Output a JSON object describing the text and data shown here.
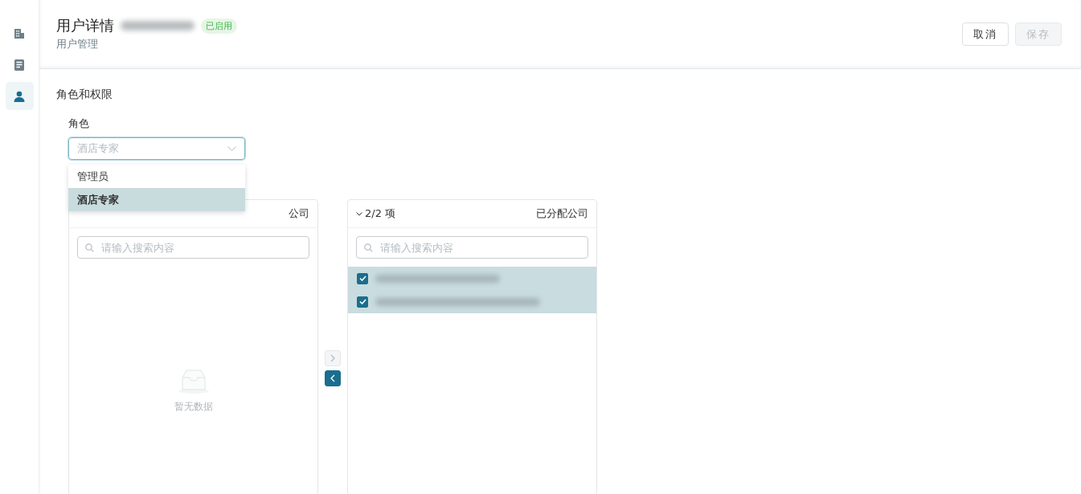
{
  "sidebar": {
    "items": [
      {
        "kind": "building",
        "selected": false
      },
      {
        "kind": "document",
        "selected": false
      },
      {
        "kind": "user",
        "selected": true
      }
    ]
  },
  "header": {
    "title": "用户详情",
    "status_badge": "已启用",
    "subtitle": "用户管理",
    "buttons": [
      {
        "label": "取消",
        "disabled": false
      },
      {
        "label": "保存",
        "disabled": true
      }
    ]
  },
  "section": {
    "title": "角色和权限",
    "role_field": {
      "label": "角色",
      "placeholder": "酒店专家",
      "expanded": true,
      "options": [
        {
          "label": "管理员",
          "selected": false
        },
        {
          "label": "酒店专家",
          "selected": true
        }
      ]
    }
  },
  "transfer": {
    "left_panel": {
      "title": "公司",
      "search": {
        "placeholder": "请输入搜索内容"
      },
      "empty_text": "暂无数据"
    },
    "right_panel": {
      "count": "2/2 项",
      "title": "已分配公司",
      "search": {
        "placeholder": "请输入搜索内容"
      },
      "items": [
        {
          "checked": true
        },
        {
          "checked": true
        }
      ]
    },
    "buttons": [
      {
        "kind": "right",
        "disabled": true
      },
      {
        "kind": "left",
        "disabled": false
      }
    ]
  }
}
